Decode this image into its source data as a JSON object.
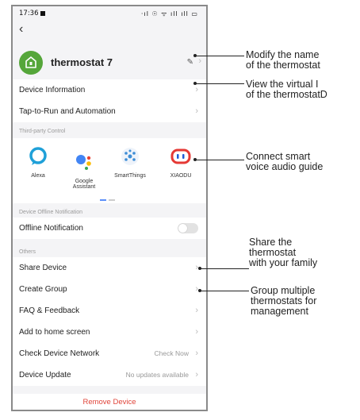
{
  "status": {
    "time": "17:36",
    "indicators": "·ıl ☉ ᯤ ıll ıll ▭"
  },
  "header": {
    "back_icon": "back-arrow-icon",
    "device_name": "thermostat 7",
    "edit_icon": "pencil-icon"
  },
  "menu1": [
    {
      "label": "Device Information"
    },
    {
      "label": "Tap-to-Run and Automation"
    }
  ],
  "third_party": {
    "label": "Third-party Control",
    "items": [
      {
        "name": "Alexa",
        "color": "#1fa0d8"
      },
      {
        "name": "Google\nAssistant",
        "color": "#4285f4"
      },
      {
        "name": "SmartThings",
        "color": "#3d8dd6"
      },
      {
        "name": "XIAODU",
        "color": "#e53935"
      }
    ]
  },
  "offline": {
    "label": "Device Offline Notification",
    "row": "Offline Notification",
    "enabled": false
  },
  "others": {
    "label": "Others",
    "rows": [
      {
        "label": "Share Device",
        "value": ""
      },
      {
        "label": "Create Group",
        "value": ""
      },
      {
        "label": "FAQ & Feedback",
        "value": ""
      },
      {
        "label": "Add to home screen",
        "value": ""
      },
      {
        "label": "Check Device Network",
        "value": "Check Now"
      },
      {
        "label": "Device Update",
        "value": "No updates available"
      }
    ]
  },
  "remove_label": "Remove Device",
  "annotations": {
    "rename": "Modify the name\nof the thermostat",
    "virtual": "View the virtual I\nof the thermostatD",
    "voice": "Connect smart\nvoice audio guide",
    "share": "Share the\nthermostat\nwith your family",
    "group": "Group multiple\nthermostats for\nmanagement"
  }
}
